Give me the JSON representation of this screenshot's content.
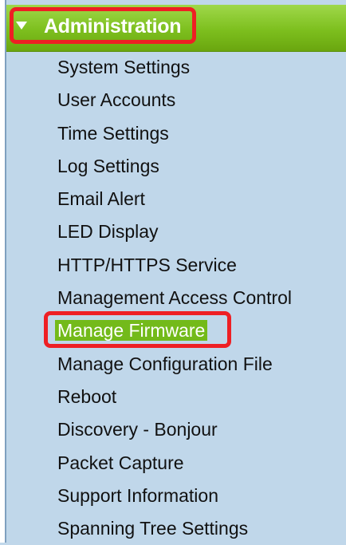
{
  "header": {
    "title": "Administration"
  },
  "menu": {
    "items": [
      {
        "label": "System Settings"
      },
      {
        "label": "User Accounts"
      },
      {
        "label": "Time Settings"
      },
      {
        "label": "Log Settings"
      },
      {
        "label": "Email Alert"
      },
      {
        "label": "LED Display"
      },
      {
        "label": "HTTP/HTTPS Service"
      },
      {
        "label": "Management Access Control"
      },
      {
        "label": "Manage Firmware"
      },
      {
        "label": "Manage Configuration File"
      },
      {
        "label": "Reboot"
      },
      {
        "label": "Discovery - Bonjour"
      },
      {
        "label": "Packet Capture"
      },
      {
        "label": "Support Information"
      },
      {
        "label": "Spanning Tree Settings"
      }
    ],
    "active_label": "Manage Firmware"
  },
  "colors": {
    "header_green": "#7dbf1e",
    "background": "#c0d7ea",
    "highlight_red": "#ee1f24",
    "active_green": "#73ba1a"
  }
}
